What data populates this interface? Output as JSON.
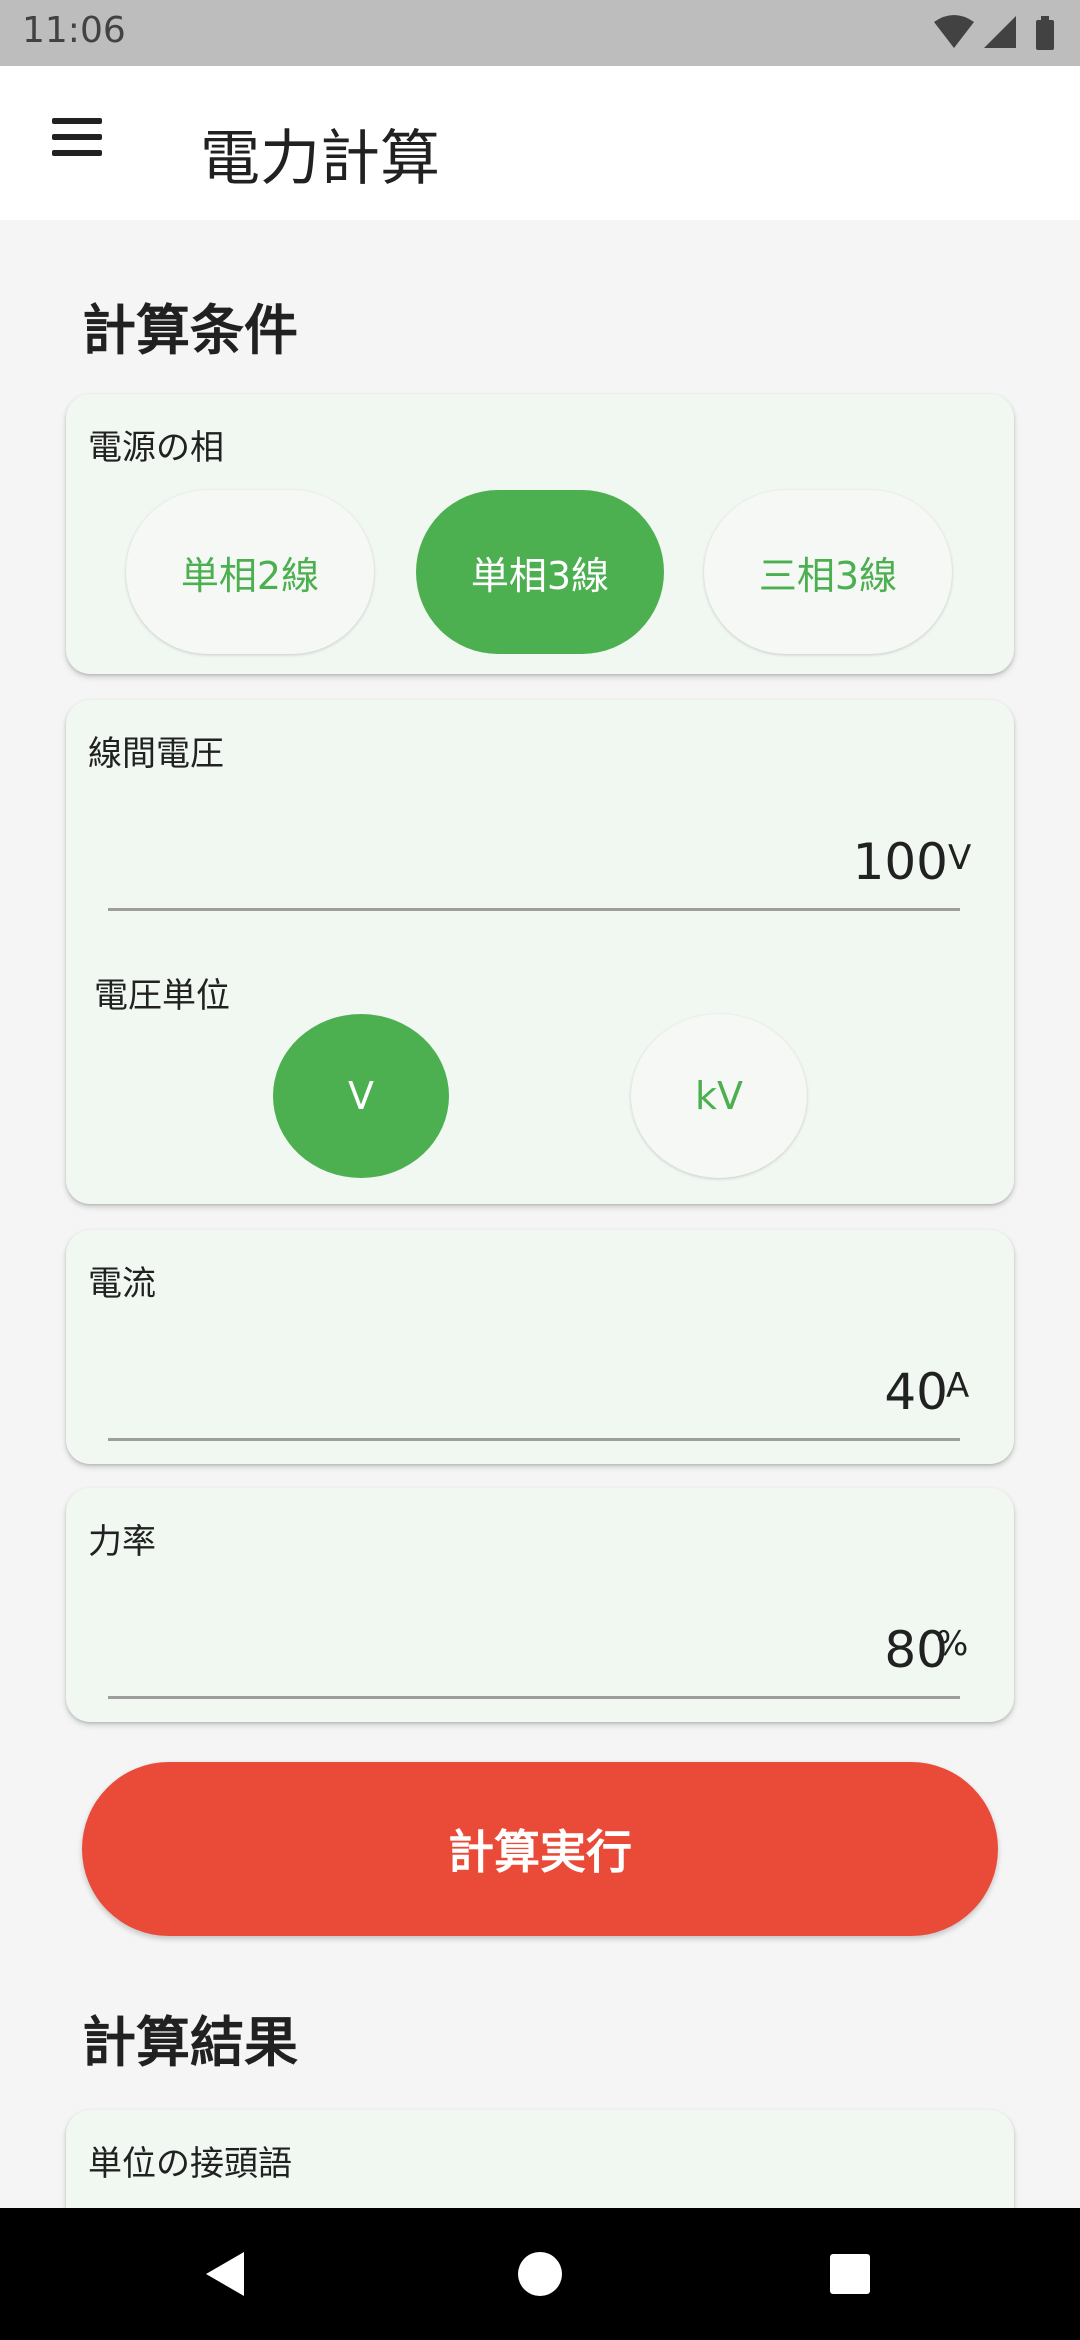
{
  "status_bar": {
    "time": "11:06",
    "icons": [
      "wifi-icon",
      "signal-icon",
      "battery-icon"
    ]
  },
  "app_bar": {
    "title": "電力計算",
    "menu_icon": "hamburger-menu-icon"
  },
  "conditions": {
    "title": "計算条件",
    "phase": {
      "label": "電源の相",
      "options": [
        "単相2線",
        "単相3線",
        "三相3線"
      ],
      "selected": "単相3線"
    },
    "voltage": {
      "label": "線間電圧",
      "value": "100",
      "unit": "V",
      "unit_label": "電圧単位",
      "unit_options": [
        "V",
        "kV"
      ],
      "unit_selected": "V"
    },
    "current": {
      "label": "電流",
      "value": "40",
      "unit": "A"
    },
    "power_factor": {
      "label": "力率",
      "value": "80",
      "unit": "%"
    }
  },
  "execute_button": "計算実行",
  "results": {
    "title": "計算結果",
    "prefix_label": "単位の接頭語"
  },
  "colors": {
    "accent": "#4caf50",
    "execute": "#ea4a38",
    "card": "#f1f8f2"
  },
  "nav_bar": {
    "icons": [
      "back-icon",
      "home-icon",
      "recents-icon"
    ]
  }
}
